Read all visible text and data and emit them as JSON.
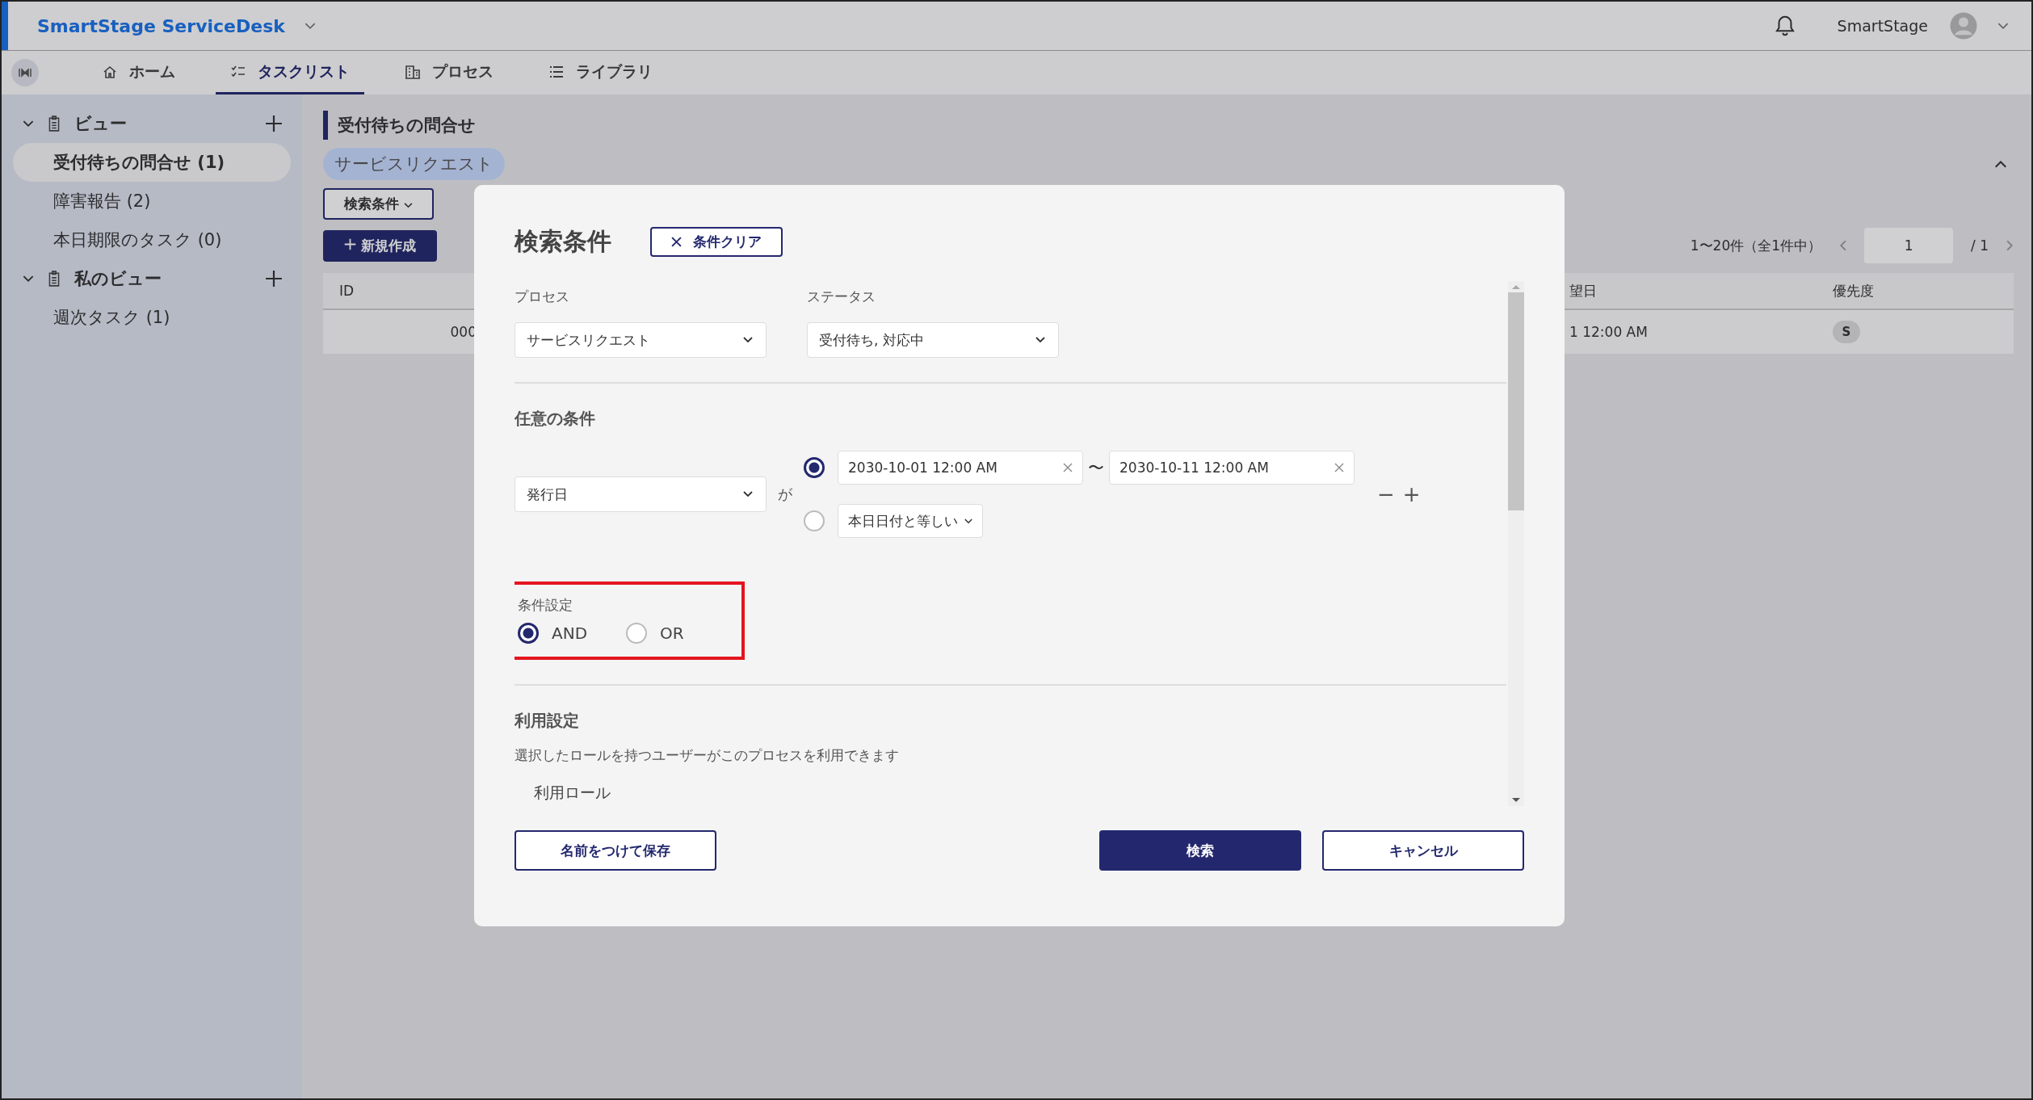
{
  "app": {
    "title": "SmartStage ServiceDesk",
    "user": "SmartStage"
  },
  "nav_tabs": [
    {
      "label": "ホーム",
      "selected": false
    },
    {
      "label": "タスクリスト",
      "selected": true
    },
    {
      "label": "プロセス",
      "selected": false
    },
    {
      "label": "ライブラリ",
      "selected": false
    }
  ],
  "sidebar": {
    "groups": [
      {
        "label": "ビュー",
        "expanded": true,
        "items": [
          {
            "label": "受付待ちの問合せ (1)",
            "selected": true
          },
          {
            "label": "障害報告 (2)",
            "selected": false
          },
          {
            "label": "本日期限のタスク (0)",
            "selected": false
          }
        ]
      },
      {
        "label": "私のビュー",
        "expanded": true,
        "items": [
          {
            "label": "週次タスク (1)",
            "selected": false
          }
        ]
      }
    ]
  },
  "page": {
    "title": "受付待ちの問合せ",
    "process_chip": "サービスリクエスト",
    "filter_button": "検索条件",
    "new_button": "新規作成",
    "pagination": {
      "range": "1〜20件（全1件中）",
      "page": "1",
      "total": "/ 1"
    },
    "table": {
      "columns": [
        "ID",
        "望日",
        "優先度"
      ],
      "rows": [
        {
          "id": "000",
          "date": "1 12:00 AM",
          "priority": "S"
        }
      ]
    }
  },
  "dialog": {
    "title": "検索条件",
    "clear_button": "条件クリア",
    "fields": [
      {
        "label": "プロセス",
        "value": "サービスリクエスト"
      },
      {
        "label": "ステータス",
        "value": "受付待ち, 対応中"
      }
    ],
    "optional": {
      "heading": "任意の条件",
      "field": "発行日",
      "particle": "が",
      "options": [
        {
          "kind": "range",
          "selected": true,
          "from": "2030-10-01 12:00 AM",
          "separator": "〜",
          "to": "2030-10-11 12:00 AM"
        },
        {
          "kind": "preset",
          "selected": false,
          "value": "本日日付と等しい"
        }
      ],
      "remove": "−",
      "add": "+"
    },
    "logic": {
      "label": "条件設定",
      "highlighted": true,
      "options": [
        {
          "label": "AND",
          "selected": true
        },
        {
          "label": "OR",
          "selected": false
        }
      ]
    },
    "usage": {
      "heading": "利用設定",
      "description": "選択したロールを持つユーザーがこのプロセスを利用できます",
      "role_label": "利用ロール"
    },
    "buttons": [
      {
        "label": "名前をつけて保存",
        "kind": "outline"
      },
      {
        "label": "検索",
        "kind": "primary"
      },
      {
        "label": "キャンセル",
        "kind": "outline"
      }
    ]
  }
}
